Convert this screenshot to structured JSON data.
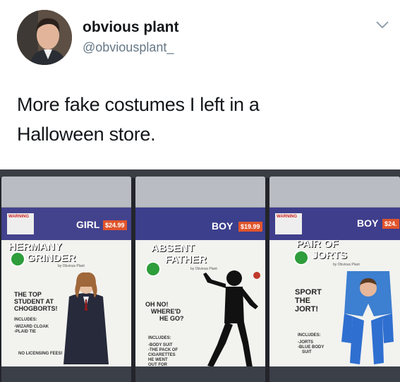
{
  "tweet": {
    "display_name": "obvious plant",
    "handle": "@obviousplant_",
    "text_line1": "More fake costumes I left in a",
    "text_line2": "Halloween store.",
    "menu_icon": "chevron-down-icon"
  },
  "photo": {
    "packages": [
      {
        "warning": "WARNING",
        "gender": "GIRL",
        "price": "$24.99",
        "title_line1": "HERMANY",
        "title_line2": "GRINDER",
        "byline": "by Obvious Plant",
        "desc_line1": "THE TOP",
        "desc_line2": "STUDENT AT",
        "desc_line3": "CHOGBORTS!",
        "includes_label": "INCLUDES:",
        "include1": "-WIZARD CLOAK",
        "include2": "-PLAID TIE",
        "footer": "NO LICENSING FEES!"
      },
      {
        "gender": "BOY",
        "price": "$19.99",
        "title_line1": "ABSENT",
        "title_line2": "FATHER",
        "byline": "by Obvious Plant",
        "desc_line1": "OH NO!",
        "desc_line2": "WHERE'D",
        "desc_line3": "HE GO?",
        "includes_label": "INCLUDES:",
        "include1": "-BODY SUIT",
        "include2": "-THE PACK OF",
        "include3": "CIGARETTES",
        "include4": "HE WENT",
        "include5": "OUT FOR"
      },
      {
        "warning": "WARNING",
        "gender": "BOY",
        "price": "$24.",
        "title_line1": "PAIR OF",
        "title_line2": "JORTS",
        "byline": "by Obvious Plant",
        "desc_line1": "SPORT",
        "desc_line2": "THE",
        "desc_line3": "JORT!",
        "includes_label": "INCLUDES:",
        "include1": "-JORTS",
        "include2": "-BLUE BODY",
        "include3": "SUIT"
      }
    ]
  }
}
